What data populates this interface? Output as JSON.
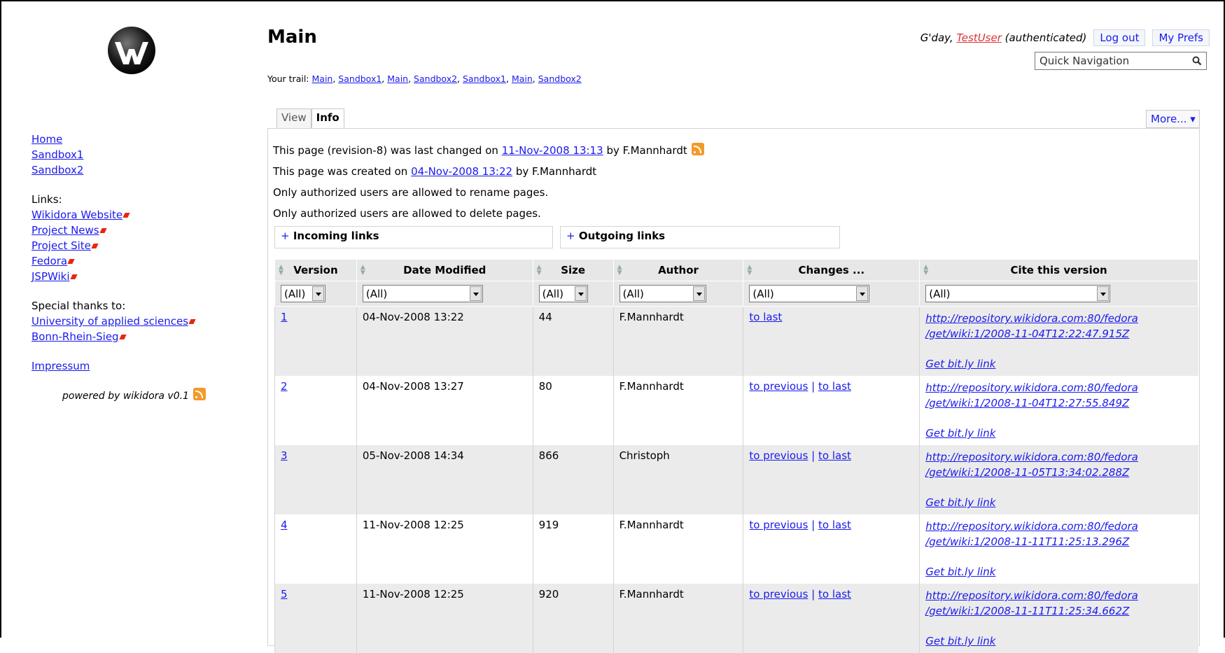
{
  "header": {
    "title": "Main",
    "trail_label": "Your trail:",
    "trail": [
      "Main",
      "Sandbox1",
      "Main",
      "Sandbox2",
      "Sandbox1",
      "Main",
      "Sandbox2"
    ],
    "greeting": "G'day,",
    "username": "TestUser",
    "auth_status": "(authenticated)",
    "logout_label": "Log out",
    "prefs_label": "My Prefs",
    "quicknav_placeholder": "Quick Navigation"
  },
  "sidebar": {
    "nav": [
      "Home",
      "Sandbox1",
      "Sandbox2"
    ],
    "links_label": "Links:",
    "links": [
      "Wikidora Website",
      "Project News",
      "Project Site",
      "Fedora",
      "JSPWiki"
    ],
    "thanks_label": "Special thanks to:",
    "thanks": [
      "University of applied sciences",
      "Bonn-Rhein-Sieg"
    ],
    "impressum": "Impressum",
    "powered": "powered by wikidora v0.1"
  },
  "tabs": {
    "view": "View",
    "info": "Info",
    "more": "More... ▾"
  },
  "info": {
    "line1_pre": "This page (revision-8) was last changed on",
    "line1_date": "11-Nov-2008 13:13",
    "line1_post": "by F.Mannhardt",
    "line2_pre": "This page was created on",
    "line2_date": "04-Nov-2008 13:22",
    "line2_post": "by F.Mannhardt",
    "line3": "Only authorized users are allowed to rename pages.",
    "line4": "Only authorized users are allowed to delete pages.",
    "incoming": "Incoming links",
    "outgoing": "Outgoing links"
  },
  "table": {
    "headers": [
      "Version",
      "Date Modified",
      "Size",
      "Author",
      "Changes ...",
      "Cite this version"
    ],
    "filter_value": "(All)",
    "to_previous": "to previous",
    "to_last": "to last",
    "bitly": "Get bit.ly link",
    "rows": [
      {
        "version": "1",
        "date": "04-Nov-2008 13:22",
        "size": "44",
        "author": "F.Mannhardt",
        "cite1": "http://repository.wikidora.com:80/fedora",
        "cite2": "/get/wiki:1/2008-11-04T12:22:47.915Z"
      },
      {
        "version": "2",
        "date": "04-Nov-2008 13:27",
        "size": "80",
        "author": "F.Mannhardt",
        "cite1": "http://repository.wikidora.com:80/fedora",
        "cite2": "/get/wiki:1/2008-11-04T12:27:55.849Z"
      },
      {
        "version": "3",
        "date": "05-Nov-2008 14:34",
        "size": "866",
        "author": "Christoph",
        "cite1": "http://repository.wikidora.com:80/fedora",
        "cite2": "/get/wiki:1/2008-11-05T13:34:02.288Z"
      },
      {
        "version": "4",
        "date": "11-Nov-2008 12:25",
        "size": "919",
        "author": "F.Mannhardt",
        "cite1": "http://repository.wikidora.com:80/fedora",
        "cite2": "/get/wiki:1/2008-11-11T11:25:13.296Z"
      },
      {
        "version": "5",
        "date": "11-Nov-2008 12:25",
        "size": "920",
        "author": "F.Mannhardt",
        "cite1": "http://repository.wikidora.com:80/fedora",
        "cite2": "/get/wiki:1/2008-11-11T11:25:34.662Z"
      }
    ]
  }
}
